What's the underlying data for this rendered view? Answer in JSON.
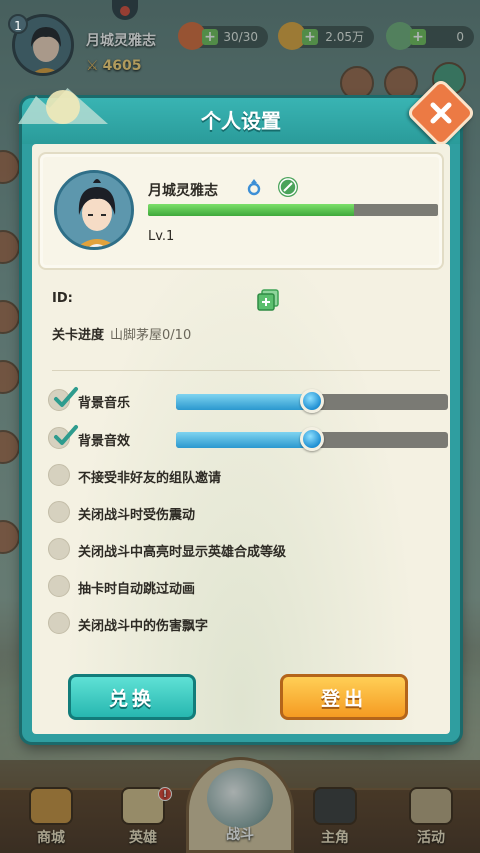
{
  "top_bar": {
    "level": "1",
    "player_name": "月城灵雅志",
    "power": "4605",
    "stamina": "30/30",
    "gold": "2.05万",
    "gems": "0"
  },
  "dialog": {
    "title": "个人设置",
    "profile": {
      "name": "月城灵雅志",
      "level": "Lv.1",
      "xp_fraction": 0.71
    },
    "id_label": "ID:",
    "stage_label": "关卡进度",
    "stage_value": "山脚茅屋0/10",
    "settings": {
      "bgm": {
        "label": "背景音乐",
        "checked": true,
        "volume": 0.5
      },
      "sfx": {
        "label": "背景音效",
        "checked": true,
        "volume": 0.5
      },
      "options": [
        {
          "label": "不接受非好友的组队邀请",
          "checked": false
        },
        {
          "label": "关闭战斗时受伤震动",
          "checked": false
        },
        {
          "label": "关闭战斗中高亮时显示英雄合成等级",
          "checked": false
        },
        {
          "label": "抽卡时自动跳过动画",
          "checked": false
        },
        {
          "label": "关闭战斗中的伤害飘字",
          "checked": false
        }
      ]
    },
    "buttons": {
      "exchange": "兑换",
      "logout": "登出"
    }
  },
  "bottom_nav": {
    "shop": "商城",
    "heroes": "英雄",
    "battle": "战斗",
    "lord": "主角",
    "events": "活动"
  },
  "colors": {
    "dialog_teal": "#2f9ea0",
    "xp_green": "#3fa93b",
    "slider_blue": "#2b98cf",
    "exchange_btn": "#27b7b0",
    "logout_btn": "#f59b22",
    "close_btn": "#ec7a44"
  }
}
